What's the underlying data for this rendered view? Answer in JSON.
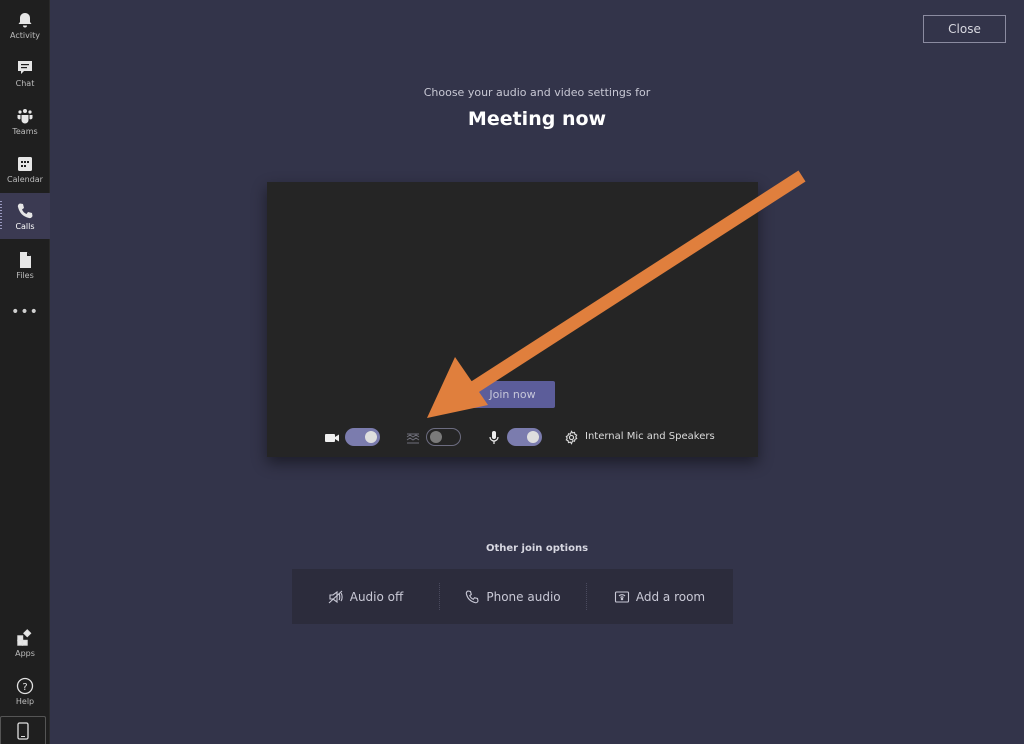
{
  "rail": {
    "items": [
      {
        "label": "Activity",
        "icon": "bell-icon"
      },
      {
        "label": "Chat",
        "icon": "chat-icon"
      },
      {
        "label": "Teams",
        "icon": "teams-icon"
      },
      {
        "label": "Calendar",
        "icon": "calendar-icon"
      },
      {
        "label": "Calls",
        "icon": "phone-icon",
        "active": true
      },
      {
        "label": "Files",
        "icon": "file-icon"
      }
    ],
    "more": "•••",
    "bottom": [
      {
        "label": "Apps",
        "icon": "apps-icon"
      },
      {
        "label": "Help",
        "icon": "help-icon"
      }
    ]
  },
  "header": {
    "close_label": "Close",
    "subtitle": "Choose your audio and video settings for",
    "title": "Meeting now"
  },
  "preview": {
    "join_label": "Join now",
    "camera_on": true,
    "background_blur_on": false,
    "mic_on": true,
    "audio_device": "Internal Mic and Speakers"
  },
  "other_join": {
    "label": "Other join options",
    "options": [
      {
        "label": "Audio off",
        "icon": "speaker-off-icon"
      },
      {
        "label": "Phone audio",
        "icon": "phone-icon"
      },
      {
        "label": "Add a room",
        "icon": "room-cast-icon"
      }
    ]
  },
  "annotation": {
    "arrow_color": "#e07f3d",
    "target": "background-blur-toggle"
  },
  "colors": {
    "background": "#33344a",
    "rail": "#1f1f1f",
    "accent": "#6264a7",
    "preview": "#252525"
  }
}
